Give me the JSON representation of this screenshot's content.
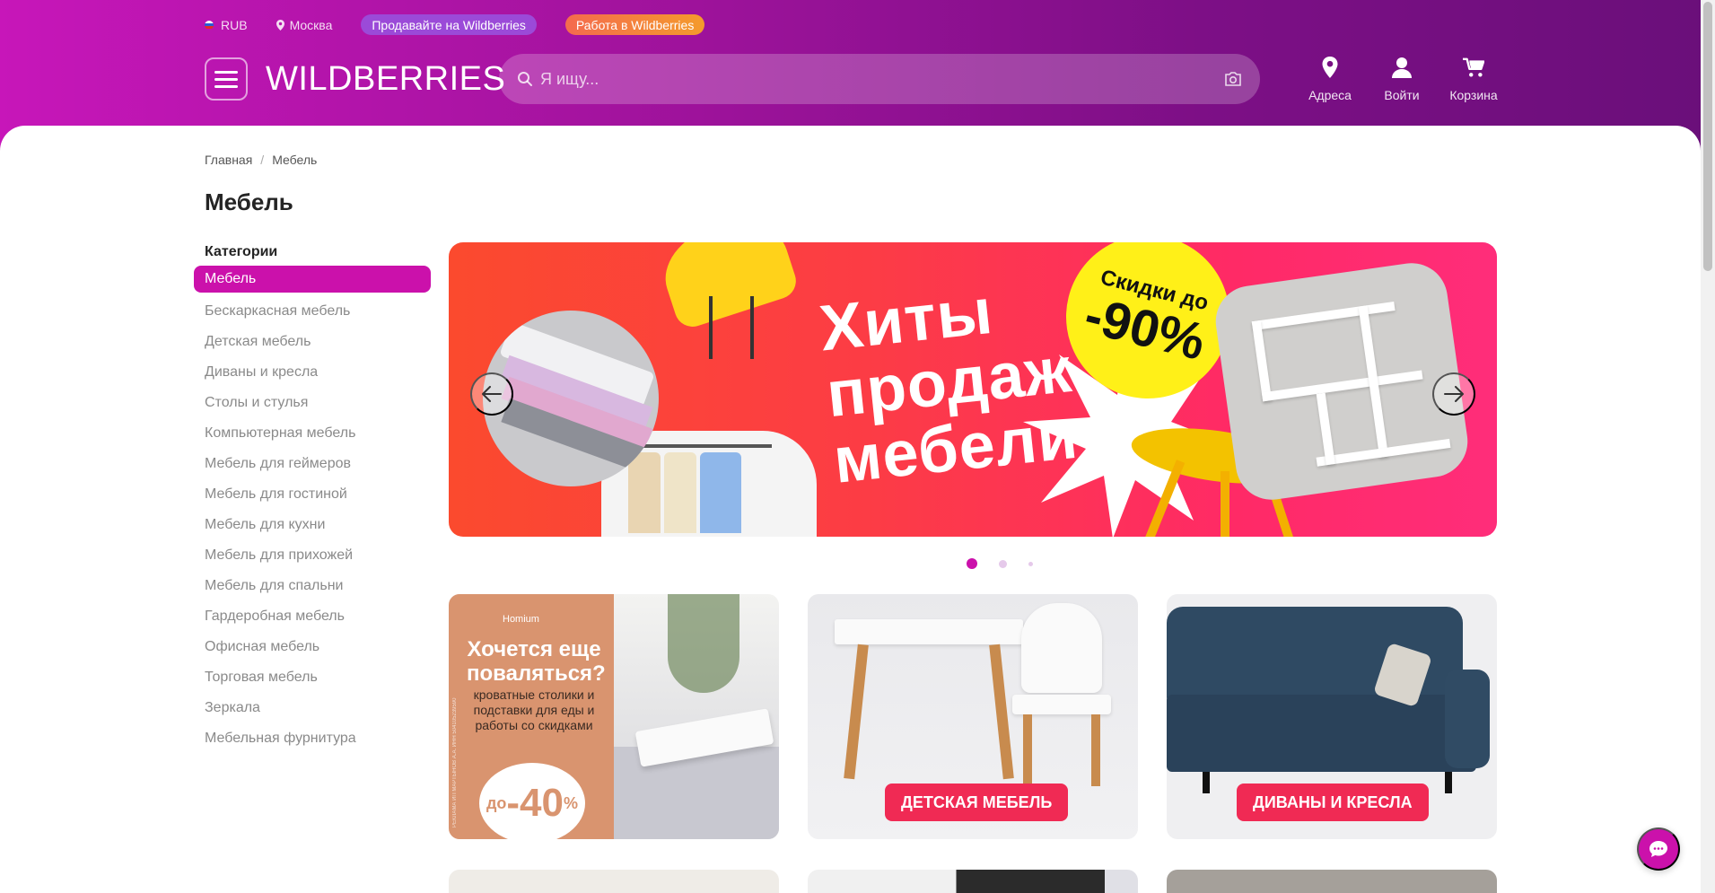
{
  "topbar": {
    "currency": "RUB",
    "city": "Москва",
    "sell_label": "Продавайте на Wildberries",
    "job_label": "Работа в Wildberries"
  },
  "header": {
    "logo": "WILDBERRIES",
    "search_placeholder": "Я ищу...",
    "nav": {
      "addresses": "Адреса",
      "login": "Войти",
      "cart": "Корзина"
    }
  },
  "breadcrumb": {
    "home": "Главная",
    "current": "Мебель"
  },
  "page": {
    "title": "Мебель"
  },
  "sidebar": {
    "title": "Категории",
    "items": [
      {
        "label": "Мебель",
        "active": true
      },
      {
        "label": "Бескаркасная мебель"
      },
      {
        "label": "Детская мебель"
      },
      {
        "label": "Диваны и кресла"
      },
      {
        "label": "Столы и стулья"
      },
      {
        "label": "Компьютерная мебель"
      },
      {
        "label": "Мебель для геймеров"
      },
      {
        "label": "Мебель для гостиной"
      },
      {
        "label": "Мебель для кухни"
      },
      {
        "label": "Мебель для прихожей"
      },
      {
        "label": "Мебель для спальни"
      },
      {
        "label": "Гардеробная мебель"
      },
      {
        "label": "Офисная мебель"
      },
      {
        "label": "Торговая мебель"
      },
      {
        "label": "Зеркала"
      },
      {
        "label": "Мебельная фурнитура"
      }
    ]
  },
  "banner": {
    "headline_1": "Хиты",
    "headline_2": "продаж",
    "headline_3": "мебели",
    "badge_text": "Скидки до",
    "badge_value": "-90%",
    "slides_total": 3,
    "active_slide": 1
  },
  "tiles": {
    "promo": {
      "brand": "Homium",
      "headline": "Хочется еще поваляться?",
      "subtitle": "кроватные столики и подставки для еды и работы со скидками",
      "discount_prefix": "до",
      "discount": "-40",
      "discount_unit": "%",
      "legal": "РЕКЛАМА ИП МАРТЫНОВ А.А. ИНН 504105239590"
    },
    "kids_label": "ДЕТСКАЯ МЕБЕЛЬ",
    "sofas_label": "ДИВАНЫ И КРЕСЛА"
  },
  "colors": {
    "brand": "#cb11ab",
    "label_red": "#f02a54",
    "badge_yellow": "#fff018"
  },
  "icons": {
    "menu": "burger-menu-icon",
    "search": "search-icon",
    "camera": "camera-icon",
    "addresses": "map-pin-icon",
    "login": "user-icon",
    "cart": "cart-icon",
    "chat": "chat-icon"
  }
}
